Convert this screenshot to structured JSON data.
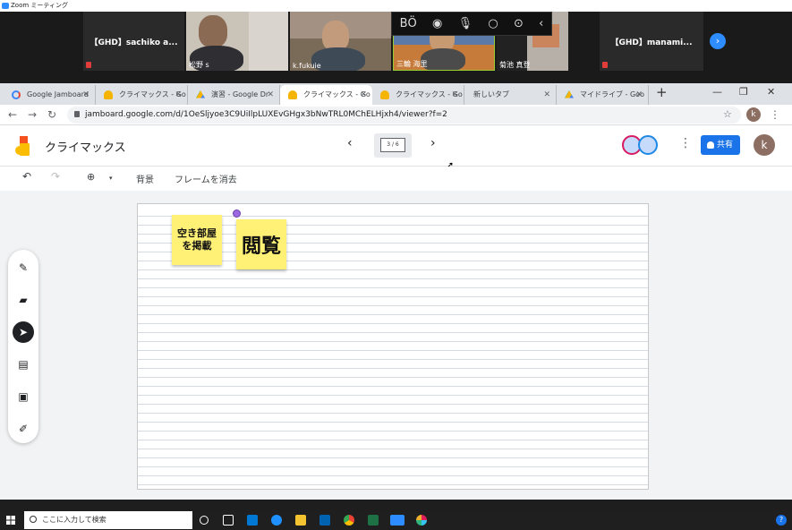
{
  "zoom": {
    "window_title": "Zoom ミーティング",
    "participants": [
      {
        "name": "【GHD】sachiko a...",
        "video": false
      },
      {
        "name": "松野 s",
        "video": true
      },
      {
        "name": "k.fukuie",
        "video": true
      },
      {
        "name": "三輪 海里",
        "video": true
      },
      {
        "name": "菊池 真登",
        "video": true
      },
      {
        "name": "【GHD】manami...",
        "video": false
      }
    ],
    "controls": [
      "ВÖ",
      "◉",
      "🎙",
      "○",
      "⊙",
      "‹"
    ],
    "next_page": "›"
  },
  "browser": {
    "tabs": [
      {
        "label": "Google Jamboard",
        "icon": "google-icon",
        "active": false
      },
      {
        "label": "クライマックス - Go",
        "icon": "jamboard-icon",
        "active": false
      },
      {
        "label": "演習 - Google Dr",
        "icon": "drive-icon",
        "active": false
      },
      {
        "label": "クライマックス - Go",
        "icon": "jamboard-icon",
        "active": true
      },
      {
        "label": "クライマックス - Go",
        "icon": "jamboard-icon",
        "active": false
      },
      {
        "label": "新しいタブ",
        "icon": "",
        "active": false
      },
      {
        "label": "マイドライブ - Goo",
        "icon": "drive-icon",
        "active": false
      }
    ],
    "new_tab": "+",
    "url": "jamboard.google.com/d/1OeSljyoe3C9UiIlpLUXEvGHgx3bNwTRL0MChELHjxh4/viewer?f=2",
    "profile_initial": "k"
  },
  "jamboard": {
    "title": "クライマックス",
    "frame_counter": "3 / 6",
    "share_label": "共有",
    "account_initial": "k",
    "toolbar": {
      "background": "背景",
      "clear_frame": "フレームを消去"
    },
    "notes": [
      {
        "text": "空き部屋を掲載",
        "color": "#fff176"
      },
      {
        "text": "閲覧",
        "color": "#fff176"
      }
    ],
    "tools": [
      "pen-icon",
      "eraser-icon",
      "select-icon",
      "sticky-note-icon",
      "image-icon",
      "laser-icon"
    ]
  },
  "taskbar": {
    "search_placeholder": "ここに入力して検索"
  }
}
